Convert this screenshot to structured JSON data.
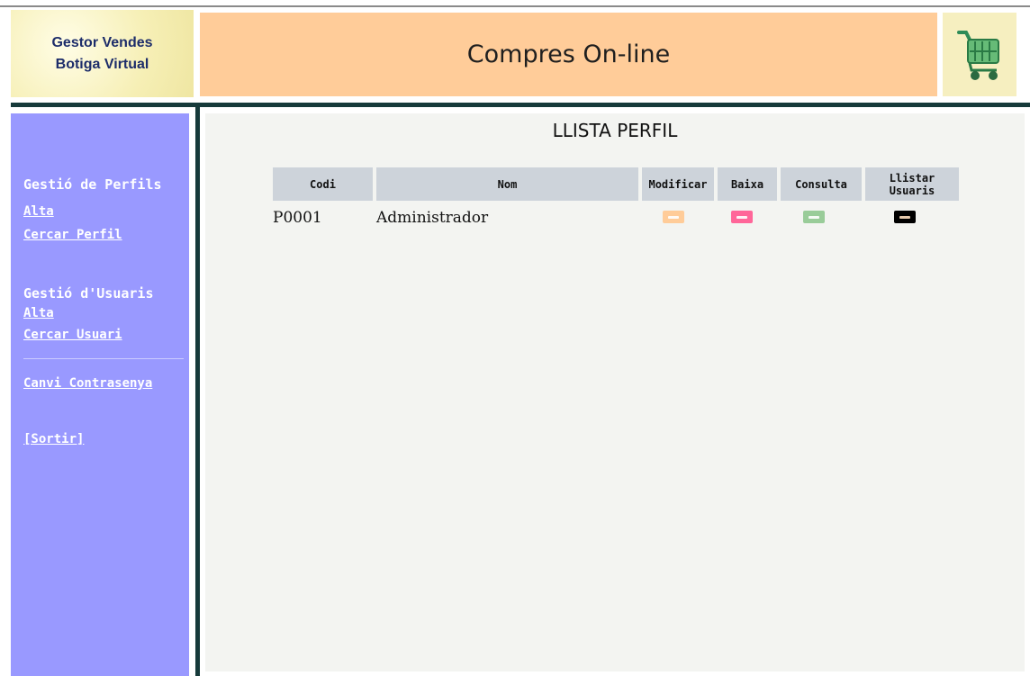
{
  "logo": {
    "line1": "Gestor Vendes",
    "line2": "Botiga Virtual"
  },
  "header": {
    "title": "Compres On-line",
    "cart_icon": "shopping-cart-icon"
  },
  "sidebar": {
    "profiles": {
      "heading": "Gestió de Perfils",
      "add": "Alta",
      "search": "Cercar Perfil"
    },
    "users": {
      "heading": "Gestió d'Usuaris",
      "add": "Alta",
      "search": "Cercar Usuari"
    },
    "change_password": "Canvi Contrasenya",
    "logout": "[Sortir]"
  },
  "main": {
    "title": "LLISTA PERFIL",
    "columns": [
      "Codi",
      "Nom",
      "Modificar",
      "Baixa",
      "Consulta",
      "Llistar Usuaris"
    ],
    "rows": [
      {
        "codi": "P0001",
        "nom": "Administrador"
      }
    ],
    "action_colors": {
      "modificar": "#ffcc99",
      "baixa": "#ff6699",
      "consulta": "#99cc99",
      "llistar": "#000000"
    }
  },
  "colors": {
    "banner": "#ffcc99",
    "sidebar": "#9999ff",
    "separator": "#163a3a",
    "table_header": "#cdd3da",
    "main_bg": "#f3f4f1"
  }
}
